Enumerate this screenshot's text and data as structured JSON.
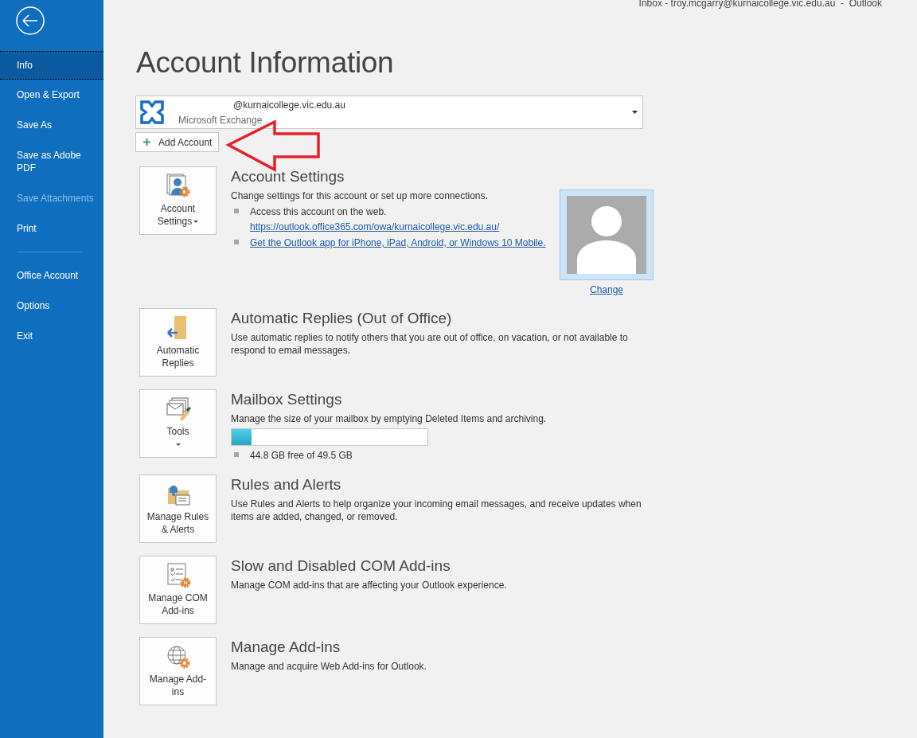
{
  "window": {
    "title": "Inbox - troy.mcgarry@kurnaicollege.vic.edu.au  -  Outlook"
  },
  "sidebar": {
    "groups": [
      [
        {
          "label": "Info",
          "selected": true,
          "disabled": false
        },
        {
          "label": "Open & Export",
          "selected": false,
          "disabled": false
        },
        {
          "label": "Save As",
          "selected": false,
          "disabled": false
        },
        {
          "label": "Save as Adobe PDF",
          "selected": false,
          "disabled": false
        },
        {
          "label": "Save Attachments",
          "selected": false,
          "disabled": true
        },
        {
          "label": "Print",
          "selected": false,
          "disabled": false
        }
      ],
      [
        {
          "label": "Office Account",
          "selected": false,
          "disabled": false
        },
        {
          "label": "Options",
          "selected": false,
          "disabled": false
        },
        {
          "label": "Exit",
          "selected": false,
          "disabled": false
        }
      ]
    ]
  },
  "page": {
    "title": "Account Information"
  },
  "account_selector": {
    "email": "@kurnaicollege.vic.edu.au",
    "type": "Microsoft Exchange"
  },
  "add_account_button": {
    "label": "Add Account"
  },
  "sections": [
    {
      "kind": "account",
      "button": {
        "label": "Account Settings",
        "dropdown": true
      },
      "title": "Account Settings",
      "description": "Change settings for this account or set up more connections.",
      "bullets": [
        {
          "text": "Access this account on the web.",
          "link": "https://outlook.office365.com/owa/kurnaicollege.vic.edu.au/"
        },
        {
          "link": "Get the Outlook app for iPhone, iPad, Android, or Windows 10 Mobile."
        }
      ],
      "photo_link": "Change"
    },
    {
      "kind": "plain",
      "button": {
        "label": "Automatic Replies",
        "dropdown": false
      },
      "title": "Automatic Replies (Out of Office)",
      "description": "Use automatic replies to notify others that you are out of office, on vacation, or not available to respond to email messages."
    },
    {
      "kind": "mailbox",
      "button": {
        "label": "Tools",
        "dropdown": true
      },
      "title": "Mailbox Settings",
      "description": "Manage the size of your mailbox by emptying Deleted Items and archiving.",
      "level": 0.1,
      "reading": "44.8 GB free of 49.5 GB"
    },
    {
      "kind": "plain",
      "button": {
        "label": "Manage Rules & Alerts",
        "dropdown": false
      },
      "title": "Rules and Alerts",
      "description": "Use Rules and Alerts to help organize your incoming email messages, and receive updates when items are added, changed, or removed."
    },
    {
      "kind": "plain",
      "button": {
        "label": "Manage COM Add-ins",
        "dropdown": false
      },
      "title": "Slow and Disabled COM Add-ins",
      "description": "Manage COM add-ins that are affecting your Outlook experience."
    },
    {
      "kind": "plain",
      "button": {
        "label": "Manage Add-ins",
        "dropdown": false
      },
      "title": "Manage Add-ins",
      "description": "Manage and acquire Web Add-ins for Outlook."
    }
  ]
}
